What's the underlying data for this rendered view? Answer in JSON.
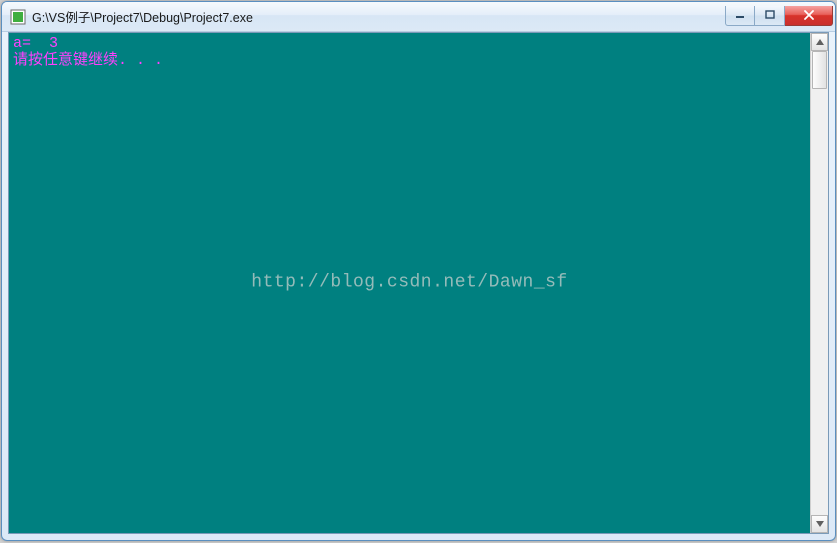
{
  "window": {
    "title": "G:\\VS例子\\Project7\\Debug\\Project7.exe"
  },
  "console": {
    "line1": "a=  3",
    "line2": "请按任意键继续. . ."
  },
  "watermark": "http://blog.csdn.net/Dawn_sf",
  "colors": {
    "console_bg": "#008080",
    "console_fg": "#ff40ff"
  }
}
